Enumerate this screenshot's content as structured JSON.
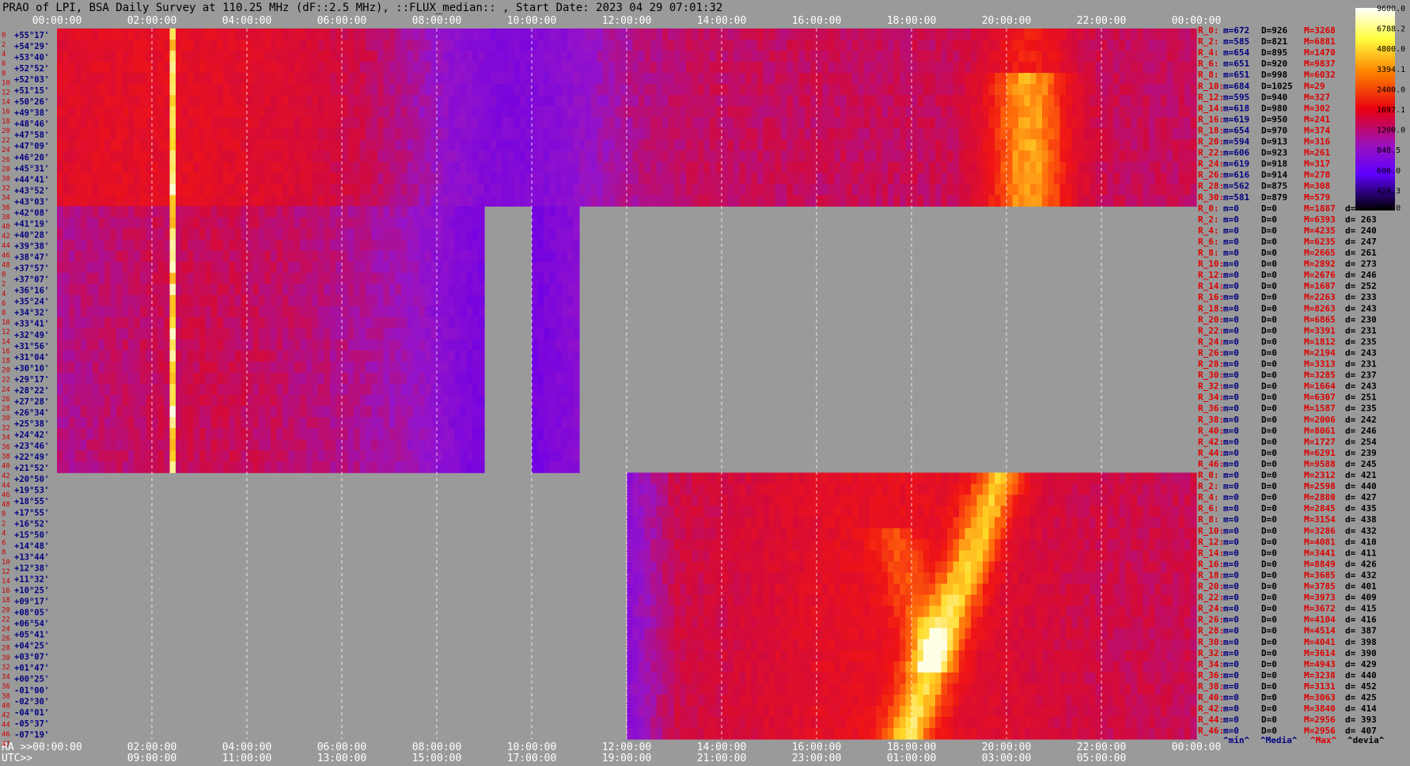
{
  "chart_data": {
    "type": "heatmap",
    "title": "PRAO of LPI, BSA Daily Survey at 110.25 MHz (dF::2.5 MHz), ::FLUX_median:: , Start Date: 2023 04 29 07:01:32",
    "x_ticks_top": [
      "00:00:00",
      "02:00:00",
      "04:00:00",
      "06:00:00",
      "08:00:00",
      "10:00:00",
      "12:00:00",
      "14:00:00",
      "16:00:00",
      "18:00:00",
      "20:00:00",
      "22:00:00",
      "00:00:00"
    ],
    "x_ticks_bottom_ra": [
      "RA >>00:00:00",
      "02:00:00",
      "04:00:00",
      "06:00:00",
      "08:00:00",
      "10:00:00",
      "12:00:00",
      "14:00:00",
      "16:00:00",
      "18:00:00",
      "20:00:00",
      "22:00:00",
      "00:00:00"
    ],
    "x_ticks_bottom_utc": [
      "UTC>>",
      "09:00:00",
      "11:00:00",
      "13:00:00",
      "15:00:00",
      "17:00:00",
      "19:00:00",
      "21:00:00",
      "23:00:00",
      "01:00:00",
      "03:00:00",
      "05:00:00"
    ],
    "row_indices": [
      "0",
      "2",
      "4",
      "6",
      "8",
      "10",
      "12",
      "14",
      "16",
      "18",
      "20",
      "22",
      "24",
      "26",
      "28",
      "30",
      "32",
      "34",
      "36",
      "38",
      "40",
      "42",
      "44",
      "46",
      "48",
      "0",
      "2",
      "4",
      "6",
      "8",
      "10",
      "12",
      "14",
      "16",
      "18",
      "20",
      "22",
      "24",
      "26",
      "28",
      "30",
      "32",
      "34",
      "36",
      "38",
      "40",
      "42",
      "44",
      "46",
      "48",
      "0",
      "2",
      "4",
      "6",
      "8",
      "10",
      "12",
      "14",
      "16",
      "18",
      "20",
      "22",
      "24",
      "26",
      "28",
      "30",
      "32",
      "34",
      "36",
      "38",
      "40",
      "42",
      "44",
      "46",
      "47"
    ],
    "dec_labels": [
      "+55°17'",
      "+54°29'",
      "+53°40'",
      "+52°52'",
      "+52°03'",
      "+51°15'",
      "+50°26'",
      "+49°38'",
      "+48°46'",
      "+47°58'",
      "+47°09'",
      "+46°20'",
      "+45°31'",
      "+44°41'",
      "+43°52'",
      "+43°03'",
      "+42°08'",
      "+41°19'",
      "+40°28'",
      "+39°38'",
      "+38°47'",
      "+37°57'",
      "+37°07'",
      "+36°16'",
      "+35°24'",
      "+34°32'",
      "+33°41'",
      "+32°49'",
      "+31°56'",
      "+31°04'",
      "+30°10'",
      "+29°17'",
      "+28°22'",
      "+27°28'",
      "+26°34'",
      "+25°38'",
      "+24°42'",
      "+23°46'",
      "+22°49'",
      "+21°52'",
      "+20°50'",
      "+19°53'",
      "+18°55'",
      "+17°55'",
      "+16°52'",
      "+15°50'",
      "+14°48'",
      "+13°44'",
      "+12°38'",
      "+11°32'",
      "+10°25'",
      "+09°17'",
      "+08°05'",
      "+06°54'",
      "+05°41'",
      "+04°25'",
      "+03°07'",
      "+01°47'",
      "+00°25'",
      "-01°00'",
      "-02°30'",
      "-04°01'",
      "-05°37'",
      "-07°19'"
    ],
    "colorbar_ticks": [
      "9600.0",
      "6788.2",
      "4800.0",
      "3394.1",
      "2400.0",
      "1697.1",
      "1200.0",
      "848.5",
      "600.0",
      "424.3",
      "300.0"
    ],
    "colorbar_range": [
      300,
      9600
    ],
    "colorbar_scale": "log",
    "stats_top": [
      {
        "r": "R_0:",
        "m": "m=672",
        "d": "D=926",
        "M": "M=3268"
      },
      {
        "r": "R_2:",
        "m": "m=585",
        "d": "D=821",
        "M": "M=6881"
      },
      {
        "r": "R_4:",
        "m": "m=654",
        "d": "D=895",
        "M": "M=1470"
      },
      {
        "r": "R_6:",
        "m": "m=651",
        "d": "D=920",
        "M": "M=9837"
      },
      {
        "r": "R_8:",
        "m": "m=651",
        "d": "D=998",
        "M": "M=6032"
      },
      {
        "r": "R_10:",
        "m": "m=684",
        "d": "D=1025",
        "M": "M=29"
      },
      {
        "r": "R_12:",
        "m": "m=595",
        "d": "D=940",
        "M": "M=327"
      },
      {
        "r": "R_14:",
        "m": "m=618",
        "d": "D=980",
        "M": "M=302"
      },
      {
        "r": "R_16:",
        "m": "m=619",
        "d": "D=950",
        "M": "M=241"
      },
      {
        "r": "R_18:",
        "m": "m=654",
        "d": "D=970",
        "M": "M=374"
      },
      {
        "r": "R_20:",
        "m": "m=594",
        "d": "D=913",
        "M": "M=316"
      },
      {
        "r": "R_22:",
        "m": "m=606",
        "d": "D=923",
        "M": "M=261"
      },
      {
        "r": "R_24:",
        "m": "m=619",
        "d": "D=918",
        "M": "M=317"
      },
      {
        "r": "R_26:",
        "m": "m=616",
        "d": "D=914",
        "M": "M=278"
      },
      {
        "r": "R_28:",
        "m": "m=562",
        "d": "D=875",
        "M": "M=308"
      },
      {
        "r": "R_30:",
        "m": "m=581",
        "d": "D=879",
        "M": "M=579"
      }
    ],
    "stats_mid": [
      {
        "r": "R_0:",
        "m": "m=0",
        "d": "D=0",
        "M": "M=1887",
        "dev": "d="
      },
      {
        "r": "R_2:",
        "m": "m=0",
        "d": "D=0",
        "M": "M=6393",
        "dev": "d= 263"
      },
      {
        "r": "R_4:",
        "m": "m=0",
        "d": "D=0",
        "M": "M=4235",
        "dev": "d= 240"
      },
      {
        "r": "R_6:",
        "m": "m=0",
        "d": "D=0",
        "M": "M=6235",
        "dev": "d= 247"
      },
      {
        "r": "R_8:",
        "m": "m=0",
        "d": "D=0",
        "M": "M=2665",
        "dev": "d= 261"
      },
      {
        "r": "R_10:",
        "m": "m=0",
        "d": "D=0",
        "M": "M=2892",
        "dev": "d= 273"
      },
      {
        "r": "R_12:",
        "m": "m=0",
        "d": "D=0",
        "M": "M=2676",
        "dev": "d= 246"
      },
      {
        "r": "R_14:",
        "m": "m=0",
        "d": "D=0",
        "M": "M=1687",
        "dev": "d= 252"
      },
      {
        "r": "R_16:",
        "m": "m=0",
        "d": "D=0",
        "M": "M=2263",
        "dev": "d= 233"
      },
      {
        "r": "R_18:",
        "m": "m=0",
        "d": "D=0",
        "M": "M=8263",
        "dev": "d= 243"
      },
      {
        "r": "R_20:",
        "m": "m=0",
        "d": "D=0",
        "M": "M=6865",
        "dev": "d= 230"
      },
      {
        "r": "R_22:",
        "m": "m=0",
        "d": "D=0",
        "M": "M=3391",
        "dev": "d= 231"
      },
      {
        "r": "R_24:",
        "m": "m=0",
        "d": "D=0",
        "M": "M=1812",
        "dev": "d= 235"
      },
      {
        "r": "R_26:",
        "m": "m=0",
        "d": "D=0",
        "M": "M=2194",
        "dev": "d= 243"
      },
      {
        "r": "R_28:",
        "m": "m=0",
        "d": "D=0",
        "M": "M=3313",
        "dev": "d= 231"
      },
      {
        "r": "R_30:",
        "m": "m=0",
        "d": "D=0",
        "M": "M=3285",
        "dev": "d= 237"
      },
      {
        "r": "R_32:",
        "m": "m=0",
        "d": "D=0",
        "M": "M=1664",
        "dev": "d= 243"
      },
      {
        "r": "R_34:",
        "m": "m=0",
        "d": "D=0",
        "M": "M=6307",
        "dev": "d= 251"
      },
      {
        "r": "R_36:",
        "m": "m=0",
        "d": "D=0",
        "M": "M=1587",
        "dev": "d= 235"
      },
      {
        "r": "R_38:",
        "m": "m=0",
        "d": "D=0",
        "M": "M=2006",
        "dev": "d= 242"
      },
      {
        "r": "R_40:",
        "m": "m=0",
        "d": "D=0",
        "M": "M=8061",
        "dev": "d= 246"
      },
      {
        "r": "R_42:",
        "m": "m=0",
        "d": "D=0",
        "M": "M=1727",
        "dev": "d= 254"
      },
      {
        "r": "R_44:",
        "m": "m=0",
        "d": "D=0",
        "M": "M=6291",
        "dev": "d= 239"
      },
      {
        "r": "R_46:",
        "m": "m=0",
        "d": "D=0",
        "M": "M=9588",
        "dev": "d= 245"
      }
    ],
    "stats_bot": [
      {
        "r": "R_0:",
        "m": "m=0",
        "d": "D=0",
        "M": "M=2312",
        "dev": "d= 421"
      },
      {
        "r": "R_2:",
        "m": "m=0",
        "d": "D=0",
        "M": "M=2598",
        "dev": "d= 440"
      },
      {
        "r": "R_4:",
        "m": "m=0",
        "d": "D=0",
        "M": "M=2880",
        "dev": "d= 427"
      },
      {
        "r": "R_6:",
        "m": "m=0",
        "d": "D=0",
        "M": "M=2845",
        "dev": "d= 435"
      },
      {
        "r": "R_8:",
        "m": "m=0",
        "d": "D=0",
        "M": "M=3154",
        "dev": "d= 438"
      },
      {
        "r": "R_10:",
        "m": "m=0",
        "d": "D=0",
        "M": "M=3286",
        "dev": "d= 432"
      },
      {
        "r": "R_12:",
        "m": "m=0",
        "d": "D=0",
        "M": "M=4081",
        "dev": "d= 410"
      },
      {
        "r": "R_14:",
        "m": "m=0",
        "d": "D=0",
        "M": "M=3441",
        "dev": "d= 411"
      },
      {
        "r": "R_16:",
        "m": "m=0",
        "d": "D=0",
        "M": "M=8849",
        "dev": "d= 426"
      },
      {
        "r": "R_18:",
        "m": "m=0",
        "d": "D=0",
        "M": "M=3685",
        "dev": "d= 432"
      },
      {
        "r": "R_20:",
        "m": "m=0",
        "d": "D=0",
        "M": "M=3785",
        "dev": "d= 401"
      },
      {
        "r": "R_22:",
        "m": "m=0",
        "d": "D=0",
        "M": "M=3973",
        "dev": "d= 409"
      },
      {
        "r": "R_24:",
        "m": "m=0",
        "d": "D=0",
        "M": "M=3672",
        "dev": "d= 415"
      },
      {
        "r": "R_26:",
        "m": "m=0",
        "d": "D=0",
        "M": "M=4104",
        "dev": "d= 416"
      },
      {
        "r": "R_28:",
        "m": "m=0",
        "d": "D=0",
        "M": "M=4514",
        "dev": "d= 387"
      },
      {
        "r": "R_30:",
        "m": "m=0",
        "d": "D=0",
        "M": "M=4041",
        "dev": "d= 398"
      },
      {
        "r": "R_32:",
        "m": "m=0",
        "d": "D=0",
        "M": "M=3614",
        "dev": "d= 390"
      },
      {
        "r": "R_34:",
        "m": "m=0",
        "d": "D=0",
        "M": "M=4943",
        "dev": "d= 429"
      },
      {
        "r": "R_36:",
        "m": "m=0",
        "d": "D=0",
        "M": "M=3238",
        "dev": "d= 440"
      },
      {
        "r": "R_38:",
        "m": "m=0",
        "d": "D=0",
        "M": "M=3131",
        "dev": "d= 452"
      },
      {
        "r": "R_40:",
        "m": "m=0",
        "d": "D=0",
        "M": "M=3063",
        "dev": "d= 425"
      },
      {
        "r": "R_42:",
        "m": "m=0",
        "d": "D=0",
        "M": "M=3840",
        "dev": "d= 414"
      },
      {
        "r": "R_44:",
        "m": "m=0",
        "d": "D=0",
        "M": "M=2956",
        "dev": "d= 393"
      },
      {
        "r": "R_46:",
        "m": "m=0",
        "d": "D=0",
        "M": "M=2956",
        "dev": "d= 407"
      }
    ],
    "stats_legend": [
      "^min^",
      "^Media^",
      "^Max^",
      "^devia^"
    ],
    "blocks": [
      {
        "name": "upper-sector",
        "ra_start_h": 0,
        "ra_end_h": 24,
        "dec_top": "+55°17'",
        "dec_bottom": "+43°03'"
      },
      {
        "name": "middle-sector",
        "ra_start_h": 0,
        "ra_end_h": 11,
        "gap_h": [
          9,
          10
        ],
        "dec_top": "+42°08'",
        "dec_bottom": "+21°52'"
      },
      {
        "name": "lower-sector",
        "ra_start_h": 12,
        "ra_end_h": 24,
        "dec_top": "+20°50'",
        "dec_bottom": "-07°19'"
      }
    ],
    "features": [
      {
        "name": "strong-source-trail",
        "ra_h": 2.4,
        "dec_range": "+55°17' to +21°52'",
        "level": "max"
      },
      {
        "name": "milky-way-arc",
        "ra_h": [
          17,
          20
        ],
        "level": "high"
      }
    ],
    "grid": true
  },
  "colors": {
    "background": "#9a9a9a",
    "top_axis_text": "#ffffff",
    "dec_label": "#000080",
    "row_index": "#cc0000",
    "stat_red": "#dd0000",
    "stat_blue": "#000080",
    "stat_black": "#000000"
  }
}
